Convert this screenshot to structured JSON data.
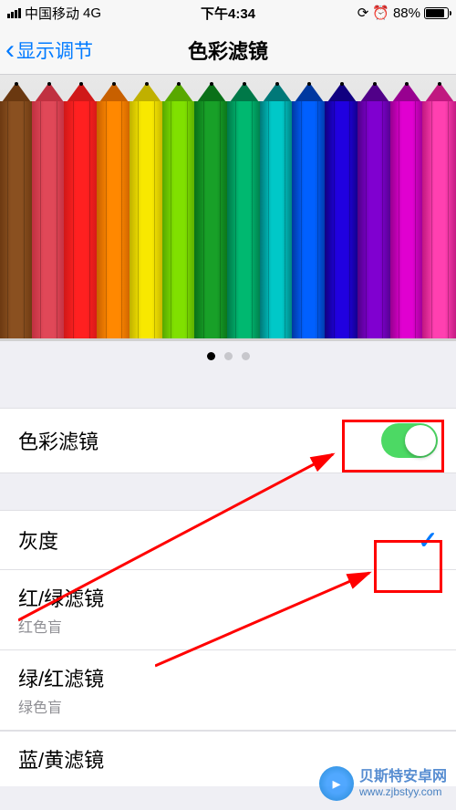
{
  "status": {
    "carrier": "中国移动",
    "network": "4G",
    "time": "下午4:34",
    "lock_icon": "lock",
    "alarm_icon": "alarm",
    "battery_pct": "88%"
  },
  "nav": {
    "back_label": "显示调节",
    "title": "色彩滤镜"
  },
  "pencils": {
    "colors": [
      {
        "tip": "#6a3810",
        "body": "#8a5020"
      },
      {
        "tip": "#c03040",
        "body": "#e04858"
      },
      {
        "tip": "#d01818",
        "body": "#ff2020"
      },
      {
        "tip": "#c86000",
        "body": "#ff8800"
      },
      {
        "tip": "#c0b000",
        "body": "#f8e800"
      },
      {
        "tip": "#58a800",
        "body": "#80e000"
      },
      {
        "tip": "#0a7018",
        "body": "#18a028"
      },
      {
        "tip": "#007848",
        "body": "#00b870"
      },
      {
        "tip": "#007878",
        "body": "#00c8c8"
      },
      {
        "tip": "#0038a0",
        "body": "#0060ff"
      },
      {
        "tip": "#100080",
        "body": "#2000e0"
      },
      {
        "tip": "#500088",
        "body": "#8000d0"
      },
      {
        "tip": "#980090",
        "body": "#e000d0"
      },
      {
        "tip": "#c01880",
        "body": "#ff40b0"
      }
    ]
  },
  "pager": {
    "current": 0,
    "total": 3
  },
  "cells": {
    "main_toggle": {
      "label": "色彩滤镜",
      "on": true
    },
    "options": [
      {
        "label": "灰度",
        "sub": "",
        "checked": true
      },
      {
        "label": "红/绿滤镜",
        "sub": "红色盲",
        "checked": false
      },
      {
        "label": "绿/红滤镜",
        "sub": "绿色盲",
        "checked": false
      },
      {
        "label": "蓝/黄滤镜",
        "sub": "",
        "checked": false
      }
    ]
  },
  "watermark": {
    "title": "贝斯特安卓网",
    "url": "www.zjbstyy.com"
  }
}
